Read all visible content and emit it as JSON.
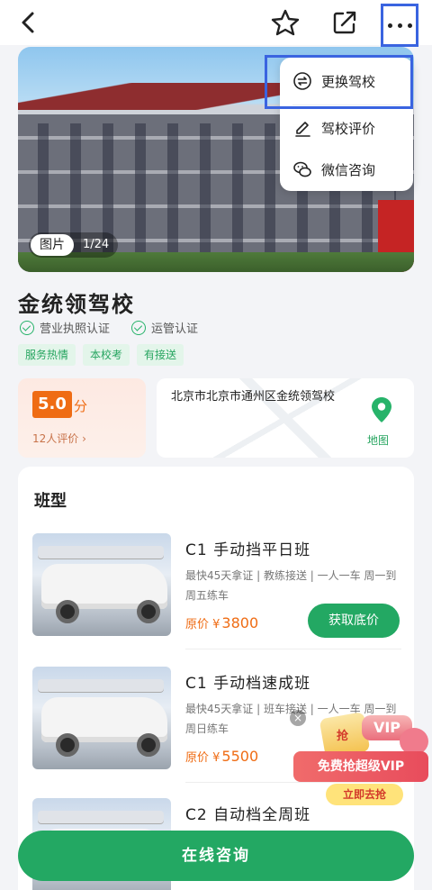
{
  "header": {
    "back_icon": "chevron-left-icon",
    "star_icon": "star-icon",
    "share_icon": "share-icon",
    "more_icon": "more-dots-icon"
  },
  "hero": {
    "photo_label": "图片",
    "counter": "1/24"
  },
  "menu": {
    "items": [
      {
        "label": "更换驾校",
        "icon": "swap-icon"
      },
      {
        "label": "驾校评价",
        "icon": "edit-icon"
      },
      {
        "label": "微信咨询",
        "icon": "wechat-icon"
      }
    ]
  },
  "school": {
    "name": "金统领驾校",
    "certs": [
      "营业执照认证",
      "运管认证"
    ],
    "tags": [
      "服务热情",
      "本校考",
      "有接送"
    ]
  },
  "rating": {
    "score": "5.0",
    "unit": "分",
    "reviews": "12人评价 ›"
  },
  "address": {
    "text": "北京市北京市通州区金统领驾校",
    "map_label": "地图"
  },
  "classes": {
    "title": "班型",
    "items": [
      {
        "name": "C1 手动挡平日班",
        "desc": "最快45天拿证 | 教练接送 | 一人一车 周一到周五练车",
        "price_label": "原价 ¥",
        "price": "3800",
        "button": "获取底价"
      },
      {
        "name": "C1 手动档速成班",
        "desc": "最快45天拿证 | 班车接送 | 一人一车 周一到周日练车",
        "price_label": "原价 ¥",
        "price": "5500",
        "button": ""
      },
      {
        "name": "C2 自动档全周班",
        "desc": "",
        "price_label": "",
        "price": "",
        "button": ""
      }
    ]
  },
  "promo": {
    "close": "×",
    "gift_label": "抢",
    "vip": "VIP",
    "banner": "免费抢超级VIP",
    "cta": "立即去抢"
  },
  "footer": {
    "consult_label": "在线咨询"
  },
  "colors": {
    "accent_green": "#23a863",
    "orange": "#ef6c14",
    "highlight_blue": "#3a64e0"
  }
}
